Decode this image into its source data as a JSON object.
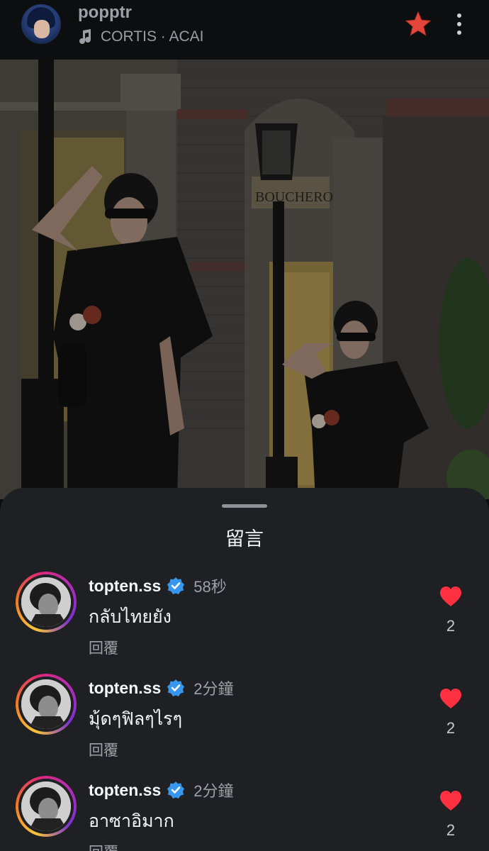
{
  "header": {
    "username": "popptr",
    "music": "CORTIS · ACAI",
    "accent_star_color": "#e5463b",
    "icons": [
      "music-note-icon",
      "star-icon",
      "more-vertical-icon"
    ]
  },
  "post": {
    "storefront_sign": "BOUCHERON"
  },
  "comments_panel": {
    "title": "留言",
    "comments": [
      {
        "username": "topten.ss",
        "verified": true,
        "time": "58秒",
        "text": "กลับไทยยัง",
        "reply_label": "回覆",
        "likes": "2"
      },
      {
        "username": "topten.ss",
        "verified": true,
        "time": "2分鐘",
        "text": "มุ้ดๆฟิลๆไรๆ",
        "reply_label": "回覆",
        "likes": "2"
      },
      {
        "username": "topten.ss",
        "verified": true,
        "time": "2分鐘",
        "text": "อาซาอิมาก",
        "reply_label": "回覆",
        "likes": "2"
      }
    ],
    "like_color": "#ff3040",
    "verified_color": "#3797f0"
  }
}
